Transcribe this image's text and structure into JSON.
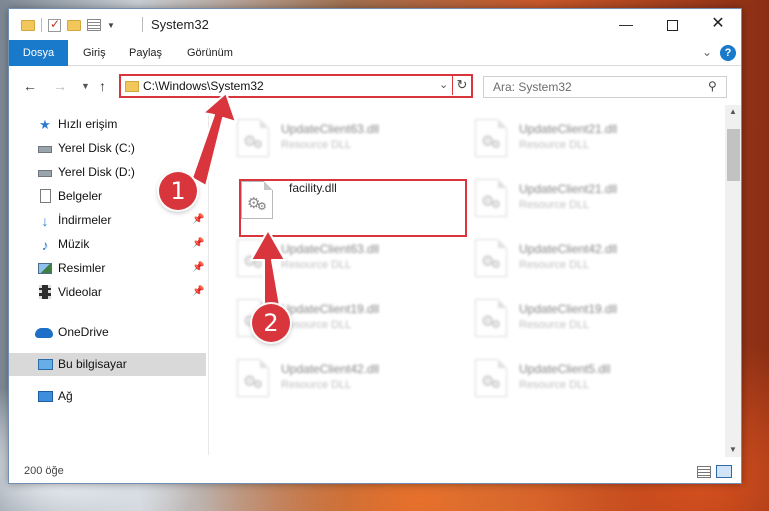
{
  "window": {
    "title": "System32",
    "controls": {
      "minimize": "—",
      "maximize": "",
      "close": "✕"
    }
  },
  "ribbon": {
    "tabs": [
      "Dosya",
      "Giriş",
      "Paylaş",
      "Görünüm"
    ],
    "help": "?"
  },
  "nav": {
    "address": "C:\\Windows\\System32",
    "search_placeholder": "Ara: System32"
  },
  "sidebar": {
    "items": [
      {
        "label": "Hızlı erişim",
        "icon": "star-icon"
      },
      {
        "label": "Yerel Disk (C:)",
        "icon": "drive-icon"
      },
      {
        "label": "Yerel Disk (D:)",
        "icon": "drive-icon"
      },
      {
        "label": "Belgeler",
        "icon": "documents-icon"
      },
      {
        "label": "İndirmeler",
        "icon": "download-icon",
        "pinned": true
      },
      {
        "label": "Müzik",
        "icon": "music-icon",
        "pinned": true
      },
      {
        "label": "Resimler",
        "icon": "pictures-icon",
        "pinned": true
      },
      {
        "label": "Videolar",
        "icon": "videos-icon",
        "pinned": true
      },
      {
        "label": "OneDrive",
        "icon": "onedrive-icon"
      },
      {
        "label": "Bu bilgisayar",
        "icon": "this-pc-icon",
        "selected": true
      },
      {
        "label": "Ağ",
        "icon": "network-icon"
      }
    ]
  },
  "files": {
    "left": [
      {
        "name": "UpdateClient63.dll",
        "type": "Resource DLL"
      },
      {
        "name": "facility.dll",
        "type": ""
      },
      {
        "name": "UpdateClient63.dll",
        "type": "Resource DLL"
      },
      {
        "name": "UpdateClient19.dll",
        "type": "Resource DLL"
      },
      {
        "name": "UpdateClient42.dll",
        "type": "Resource DLL"
      }
    ],
    "right": [
      {
        "name": "UpdateClient21.dll",
        "type": "Resource DLL"
      },
      {
        "name": "UpdateClient21.dll",
        "type": "Resource DLL"
      },
      {
        "name": "UpdateClient42.dll",
        "type": "Resource DLL"
      },
      {
        "name": "UpdateClient19.dll",
        "type": "Resource DLL"
      },
      {
        "name": "UpdateClient5.dll",
        "type": "Resource DLL"
      }
    ]
  },
  "status": {
    "item_count": "200 öğe"
  },
  "annotations": {
    "step1": "1",
    "step2": "2",
    "color": "#d8363c"
  }
}
